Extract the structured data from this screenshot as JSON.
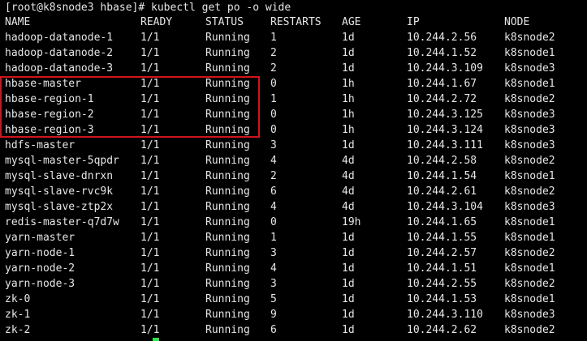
{
  "terminal": {
    "prompt": "[root@k8snode3 hbase]#",
    "command": "kubectl get po -o wide",
    "headers": {
      "name": "NAME",
      "ready": "READY",
      "status": "STATUS",
      "restarts": "RESTARTS",
      "age": "AGE",
      "ip": "IP",
      "node": "NODE"
    },
    "rows": [
      {
        "name": "hadoop-datanode-1",
        "ready": "1/1",
        "status": "Running",
        "restarts": "1",
        "age": "1d",
        "ip": "10.244.2.56",
        "node": "k8snode2"
      },
      {
        "name": "hadoop-datanode-2",
        "ready": "1/1",
        "status": "Running",
        "restarts": "2",
        "age": "1d",
        "ip": "10.244.1.52",
        "node": "k8snode1"
      },
      {
        "name": "hadoop-datanode-3",
        "ready": "1/1",
        "status": "Running",
        "restarts": "2",
        "age": "1d",
        "ip": "10.244.3.109",
        "node": "k8snode3"
      },
      {
        "name": "hbase-master",
        "ready": "1/1",
        "status": "Running",
        "restarts": "0",
        "age": "1h",
        "ip": "10.244.1.67",
        "node": "k8snode1"
      },
      {
        "name": "hbase-region-1",
        "ready": "1/1",
        "status": "Running",
        "restarts": "1",
        "age": "1h",
        "ip": "10.244.2.72",
        "node": "k8snode2"
      },
      {
        "name": "hbase-region-2",
        "ready": "1/1",
        "status": "Running",
        "restarts": "0",
        "age": "1h",
        "ip": "10.244.3.125",
        "node": "k8snode3"
      },
      {
        "name": "hbase-region-3",
        "ready": "1/1",
        "status": "Running",
        "restarts": "0",
        "age": "1h",
        "ip": "10.244.3.124",
        "node": "k8snode3"
      },
      {
        "name": "hdfs-master",
        "ready": "1/1",
        "status": "Running",
        "restarts": "3",
        "age": "1d",
        "ip": "10.244.3.111",
        "node": "k8snode3"
      },
      {
        "name": "mysql-master-5qpdr",
        "ready": "1/1",
        "status": "Running",
        "restarts": "4",
        "age": "4d",
        "ip": "10.244.2.58",
        "node": "k8snode2"
      },
      {
        "name": "mysql-slave-dnrxn",
        "ready": "1/1",
        "status": "Running",
        "restarts": "2",
        "age": "4d",
        "ip": "10.244.1.54",
        "node": "k8snode1"
      },
      {
        "name": "mysql-slave-rvc9k",
        "ready": "1/1",
        "status": "Running",
        "restarts": "6",
        "age": "4d",
        "ip": "10.244.2.61",
        "node": "k8snode2"
      },
      {
        "name": "mysql-slave-ztp2x",
        "ready": "1/1",
        "status": "Running",
        "restarts": "4",
        "age": "4d",
        "ip": "10.244.3.104",
        "node": "k8snode3"
      },
      {
        "name": "redis-master-q7d7w",
        "ready": "1/1",
        "status": "Running",
        "restarts": "0",
        "age": "19h",
        "ip": "10.244.1.65",
        "node": "k8snode1"
      },
      {
        "name": "yarn-master",
        "ready": "1/1",
        "status": "Running",
        "restarts": "1",
        "age": "1d",
        "ip": "10.244.1.55",
        "node": "k8snode1"
      },
      {
        "name": "yarn-node-1",
        "ready": "1/1",
        "status": "Running",
        "restarts": "3",
        "age": "1d",
        "ip": "10.244.2.57",
        "node": "k8snode2"
      },
      {
        "name": "yarn-node-2",
        "ready": "1/1",
        "status": "Running",
        "restarts": "4",
        "age": "1d",
        "ip": "10.244.1.51",
        "node": "k8snode1"
      },
      {
        "name": "yarn-node-3",
        "ready": "1/1",
        "status": "Running",
        "restarts": "3",
        "age": "1d",
        "ip": "10.244.2.55",
        "node": "k8snode2"
      },
      {
        "name": "zk-0",
        "ready": "1/1",
        "status": "Running",
        "restarts": "5",
        "age": "1d",
        "ip": "10.244.1.53",
        "node": "k8snode1"
      },
      {
        "name": "zk-1",
        "ready": "1/1",
        "status": "Running",
        "restarts": "9",
        "age": "1d",
        "ip": "10.244.3.110",
        "node": "k8snode3"
      },
      {
        "name": "zk-2",
        "ready": "1/1",
        "status": "Running",
        "restarts": "6",
        "age": "1d",
        "ip": "10.244.2.62",
        "node": "k8snode2"
      }
    ]
  },
  "colors": {
    "background": "#000000",
    "text": "#e6e6e6",
    "highlight_border": "#d0151b",
    "cursor": "#34e34a"
  }
}
